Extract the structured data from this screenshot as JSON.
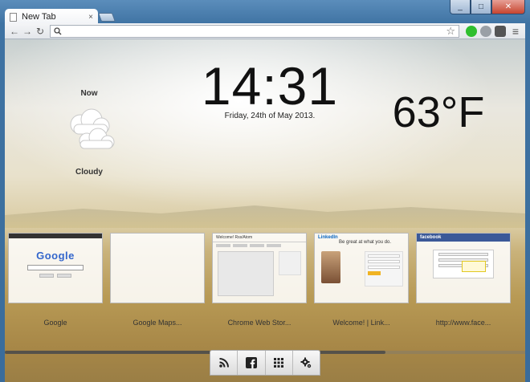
{
  "tab": {
    "title": "New Tab",
    "close": "×"
  },
  "window": {
    "minimize": "_",
    "maximize": "□",
    "close": "✕"
  },
  "toolbar": {
    "back": "←",
    "forward": "→",
    "reload": "↻",
    "url_value": "",
    "star": "☆",
    "menu": "≡"
  },
  "weather": {
    "label_now": "Now",
    "condition": "Cloudy",
    "temperature": "63°F",
    "icon": "cloudy-icon"
  },
  "clock": {
    "time": "14:31",
    "date": "Friday, 24th of May 2013."
  },
  "thumbnails": [
    {
      "label": "Google",
      "logo": "Google"
    },
    {
      "label": "Google Maps..."
    },
    {
      "label": "Chrome Web Stor...",
      "header": "Welcome! Rss/Atom"
    },
    {
      "label": "Welcome! | Link...",
      "logo": "LinkedIn",
      "tagline": "Be great at what you do."
    },
    {
      "label": "http://www.face...",
      "logo": "facebook"
    }
  ],
  "dock": {
    "items": [
      "rss-icon",
      "facebook-icon",
      "apps-grid-icon",
      "settings-gear-icon"
    ]
  },
  "colors": {
    "accent_facebook": "#3b5998",
    "linkedin_blue": "#0a66c2",
    "extension_green": "#2fbf2f"
  }
}
